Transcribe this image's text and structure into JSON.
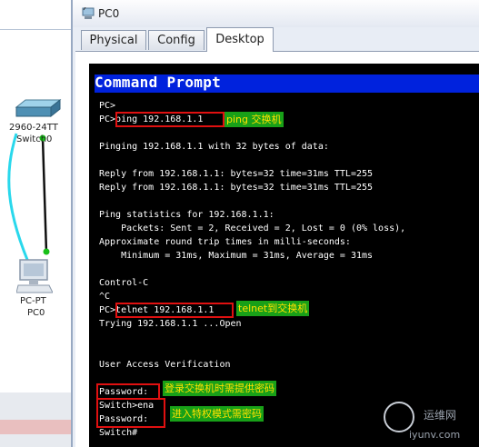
{
  "window": {
    "title": "PC0"
  },
  "tabs": [
    {
      "label": "Physical"
    },
    {
      "label": "Config"
    },
    {
      "label": "Desktop"
    }
  ],
  "active_tab": "Desktop",
  "workspace": {
    "switch_label_1": "2960-24TT",
    "switch_label_2": "Switch0",
    "pc_label_1": "PC-PT",
    "pc_label_2": "PC0"
  },
  "command_prompt": {
    "title": "Command Prompt",
    "lines": [
      "PC>",
      "PC>ping 192.168.1.1",
      "",
      "Pinging 192.168.1.1 with 32 bytes of data:",
      "",
      "Reply from 192.168.1.1: bytes=32 time=31ms TTL=255",
      "Reply from 192.168.1.1: bytes=32 time=31ms TTL=255",
      "",
      "Ping statistics for 192.168.1.1:",
      "    Packets: Sent = 2, Received = 2, Lost = 0 (0% loss),",
      "Approximate round trip times in milli-seconds:",
      "    Minimum = 31ms, Maximum = 31ms, Average = 31ms",
      "",
      "Control-C",
      "^C",
      "PC>telnet 192.168.1.1",
      "Trying 192.168.1.1 ...Open",
      "",
      "",
      "User Access Verification",
      "",
      "Password:",
      "Switch>ena",
      "Password:",
      "Switch#"
    ]
  },
  "annotations": {
    "ping": "ping 交换机",
    "telnet": "telnet到交换机",
    "login_password": "登录交换机时需提供密码",
    "privileged_password": "进入特权模式需密码"
  },
  "watermark": {
    "brand": "运维网",
    "url": "iyunv.com"
  },
  "colors": {
    "prompt_bar": "#0022dd",
    "note_bg": "#18a018",
    "note_text": "#ffe100",
    "highlight_box": "#e01010"
  }
}
